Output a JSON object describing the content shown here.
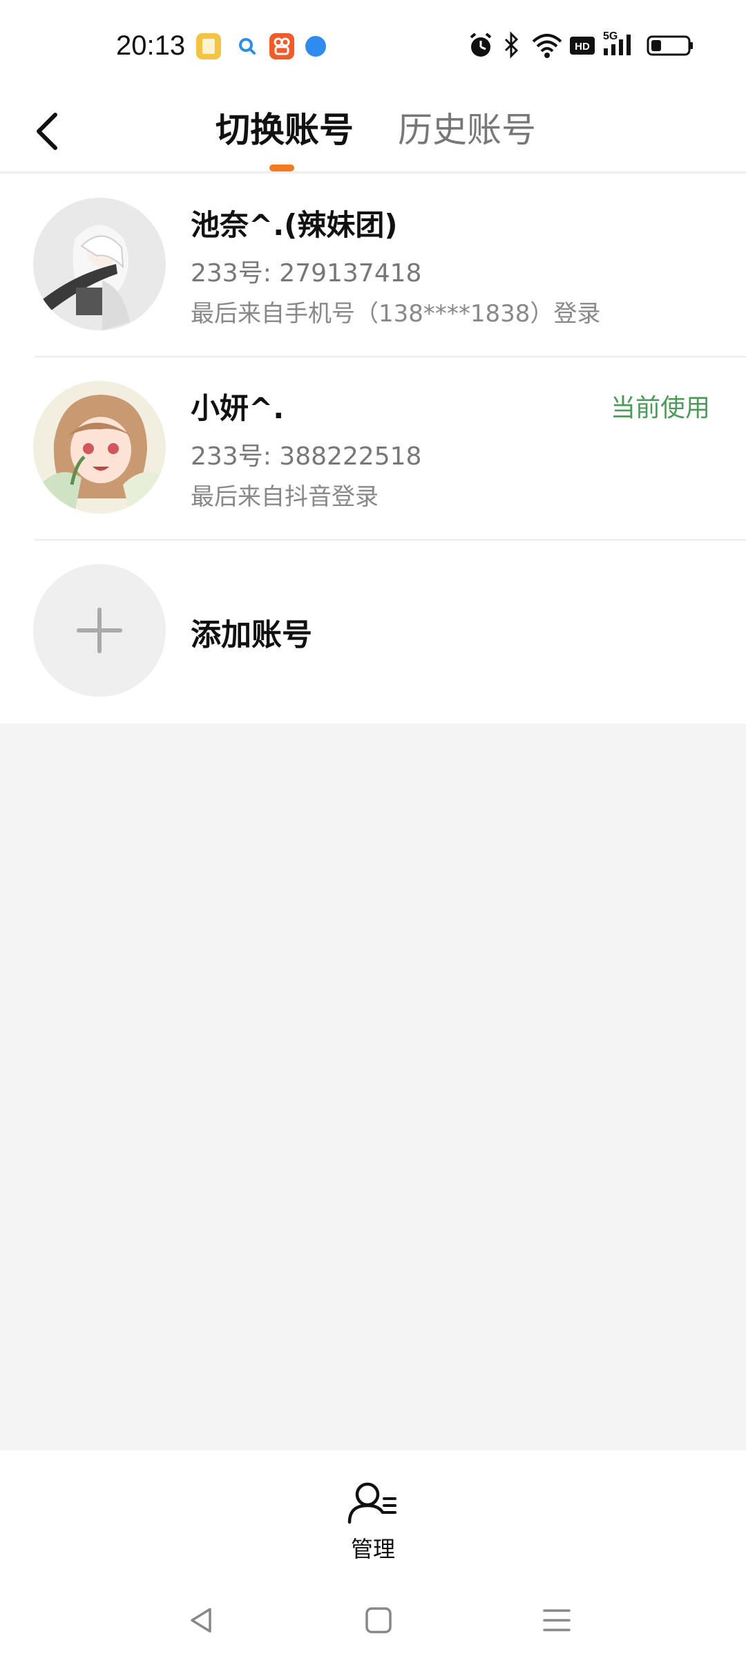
{
  "status_bar": {
    "time": "20:13",
    "icons": [
      "alarm-icon",
      "bluetooth-icon",
      "wifi-icon",
      "hd-icon",
      "5g-signal-icon",
      "battery-icon"
    ],
    "network": "5G",
    "hd": "HD"
  },
  "header": {
    "tabs": [
      {
        "label": "切换账号",
        "active": true
      },
      {
        "label": "历史账号",
        "active": false
      }
    ]
  },
  "accounts": [
    {
      "name": "池奈^.(辣妹团)",
      "id_text": "233号: 279137418",
      "from_text": "最后来自手机号（138****1838）登录",
      "current": false
    },
    {
      "name": "小妍^.",
      "id_text": "233号: 388222518",
      "from_text": "最后来自抖音登录",
      "current": true,
      "current_label": "当前使用"
    }
  ],
  "add_account": {
    "label": "添加账号"
  },
  "bottom": {
    "manage_label": "管理"
  },
  "colors": {
    "accent": "#f47a20",
    "current": "#4c9a5a",
    "background": "#f4f4f4"
  }
}
